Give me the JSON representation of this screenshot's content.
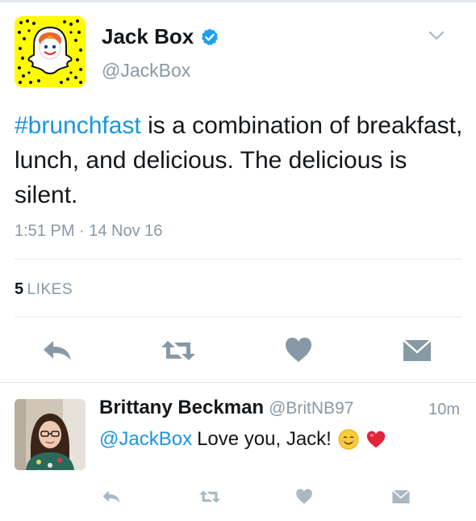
{
  "tweet": {
    "author_name": "Jack Box",
    "author_handle": "@JackBox",
    "verified_icon": "verified-badge-icon",
    "hashtag": "#brunchfast",
    "text_rest": " is a combination of breakfast, lunch, and delicious. The delicious is silent.",
    "timestamp": "1:51 PM · 14 Nov 16",
    "likes_count": "5",
    "likes_label": "LIKES"
  },
  "reply": {
    "author_name": "Brittany Beckman",
    "author_handle": "@BritNB97",
    "time": "10m",
    "mention": "@JackBox",
    "text": "Love you, Jack!",
    "emojis": [
      "smiling-face-emoji",
      "heart-emoji"
    ]
  },
  "actions": [
    "reply-icon",
    "retweet-icon",
    "like-icon",
    "message-icon"
  ],
  "colors": {
    "link": "#1b95e0",
    "secondary": "#8899a6",
    "text": "#14171a",
    "icon": "#8899a6",
    "snapchat_yellow": "#fffc00"
  }
}
